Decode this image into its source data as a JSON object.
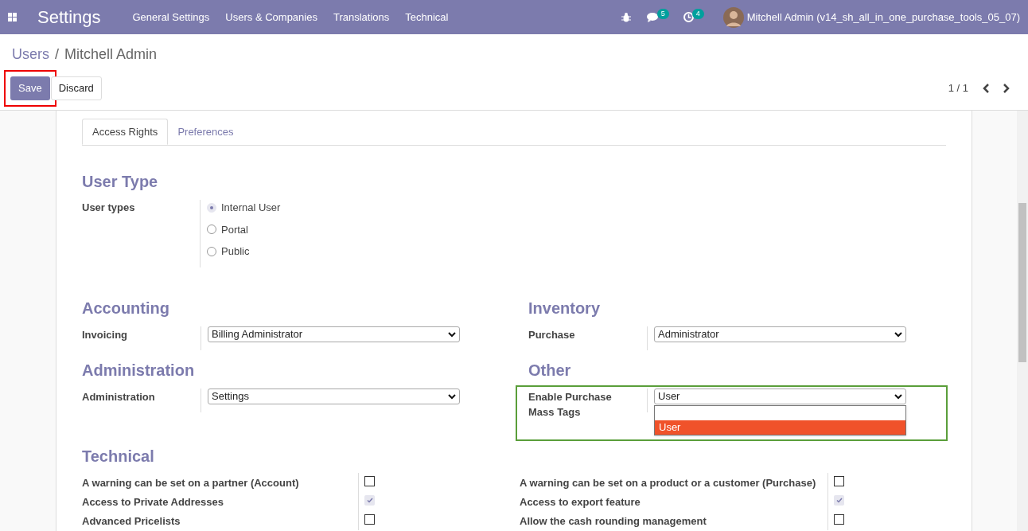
{
  "navbar": {
    "app_title": "Settings",
    "menu": [
      "General Settings",
      "Users & Companies",
      "Translations",
      "Technical"
    ],
    "messages_count": "5",
    "activities_count": "4",
    "user": "Mitchell Admin (v14_sh_all_in_one_purchase_tools_05_07)"
  },
  "breadcrumb": [
    "Users",
    "/",
    "Mitchell Admin"
  ],
  "buttons": [
    {
      "label": "Save",
      "kind": "primary"
    },
    {
      "label": "Discard",
      "kind": "secondary"
    }
  ],
  "pager": "1 / 1",
  "tabs": [
    {
      "label": "Access Rights",
      "selected": true
    },
    {
      "label": "Preferences",
      "selected": false
    }
  ],
  "user_type": {
    "title": "User Type",
    "label": "User types",
    "options": [
      {
        "label": "Internal User",
        "selected": true
      },
      {
        "label": "Portal",
        "selected": false
      },
      {
        "label": "Public",
        "selected": false
      }
    ]
  },
  "groups": [
    {
      "title": "Accounting",
      "label": "Invoicing",
      "value": "Billing Administrator"
    },
    {
      "title": "Inventory",
      "label": "Purchase",
      "value": "Administrator"
    },
    {
      "title": "Administration",
      "label": "Administration",
      "value": "Settings"
    },
    {
      "title": "Other",
      "label": "Enable Purchase Mass Tags",
      "value": "User",
      "highlighted": true,
      "open": true,
      "options": [
        {
          "label": "User",
          "selected": true
        }
      ]
    }
  ],
  "technical": {
    "title": "Technical",
    "items": [
      {
        "label": "A warning can be set on a partner (Account)",
        "checked": false
      },
      {
        "label": "A warning can be set on a product or a customer (Purchase)",
        "checked": false
      },
      {
        "label": "Access to Private Addresses",
        "checked": true
      },
      {
        "label": "Access to export feature",
        "checked": true
      },
      {
        "label": "Advanced Pricelists",
        "checked": false
      },
      {
        "label": "Allow the cash rounding management",
        "checked": false
      }
    ]
  }
}
